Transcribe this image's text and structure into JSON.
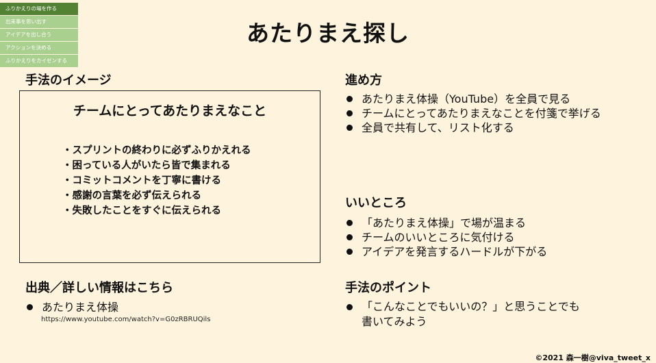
{
  "nav": [
    "ふりかえりの場を作る",
    "出来事を思い出す",
    "アイデアを出し合う",
    "アクションを決める",
    "ふりかえりをカイゼンする"
  ],
  "title": "あたりまえ探し",
  "image_section": {
    "heading": "手法のイメージ",
    "box_title": "チームにとってあたりまえなこと",
    "items": [
      "・スプリントの終わりに必ずふりかえれる",
      "・困っている人がいたら皆で集まれる",
      "・コミットコメントを丁寧に書ける",
      "・感謝の言葉を必ず伝えられる",
      "・失敗したことをすぐに伝えられる"
    ]
  },
  "steps": {
    "heading": "進め方",
    "items": [
      "あたりまえ体操（YouTube）を全員で見る",
      "チームにとってあたりまえなことを付箋で挙げる",
      "全員で共有して、リスト化する"
    ]
  },
  "good": {
    "heading": "いいところ",
    "items": [
      "「あたりまえ体操」で場が温まる",
      "チームのいいところに気付ける",
      "アイデアを発言するハードルが下がる"
    ]
  },
  "source": {
    "heading": "出典／詳しい情報はこちら",
    "item": "あたりまえ体操",
    "url": "https://www.youtube.com/watch?v=G0zRBRUQils"
  },
  "points": {
    "heading": "手法のポイント",
    "line1": "「こんなことでもいいの？」と思うことでも",
    "line2": "書いてみよう"
  },
  "copyright": "©2021 森一樹@viva_tweet_x"
}
